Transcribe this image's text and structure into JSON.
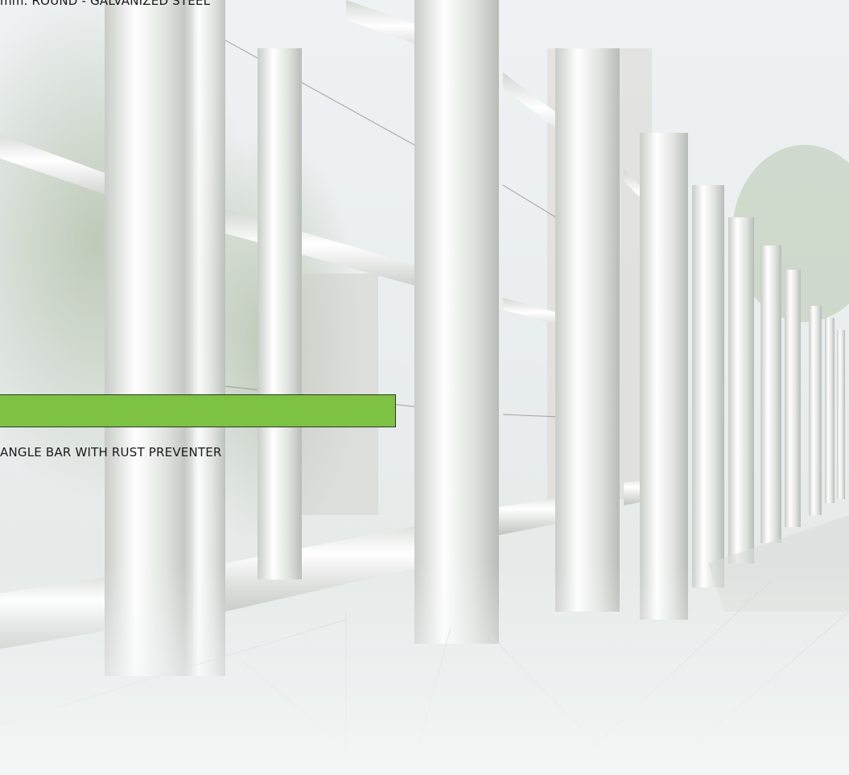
{
  "top_caption": "mm. ROUND - GALVANIZED STEEL",
  "green_bar_label": "",
  "spec_caption": "ANGLE BAR WITH RUST PREVENTER",
  "background": {
    "subject": "steel railing photo",
    "tint": "#f2f4f3"
  },
  "colors": {
    "accent_green": "#7dc243",
    "text": "#1a1a1a"
  }
}
